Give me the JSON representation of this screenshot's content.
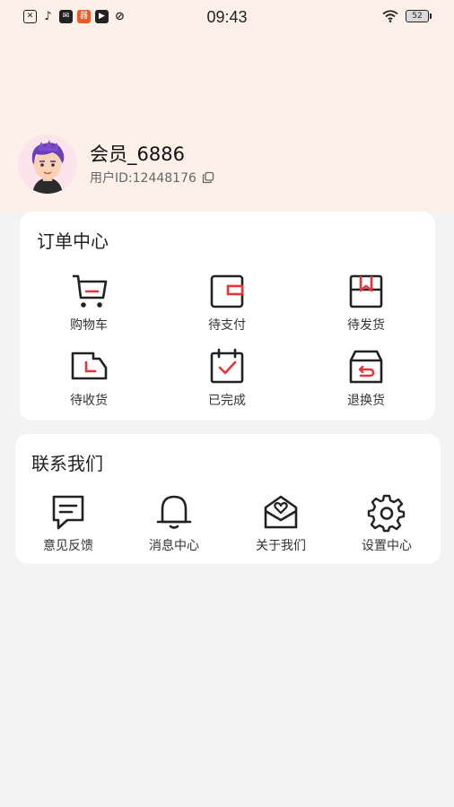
{
  "status_bar": {
    "time": "09:43",
    "battery": "52",
    "notification_icons": [
      "sim-icon",
      "tiktok-icon",
      "mail-icon",
      "app-icon",
      "video-icon",
      "link-icon"
    ],
    "app_icon_glyph": "器"
  },
  "profile": {
    "username": "会员_6886",
    "user_id": "用户ID:12448176"
  },
  "order_center": {
    "title": "订单中心",
    "items": [
      {
        "label": "购物车",
        "icon": "cart-icon"
      },
      {
        "label": "待支付",
        "icon": "wallet-icon"
      },
      {
        "label": "待发货",
        "icon": "box-bookmark-icon"
      },
      {
        "label": "待收货",
        "icon": "truck-icon"
      },
      {
        "label": "已完成",
        "icon": "calendar-check-icon"
      },
      {
        "label": "退换货",
        "icon": "return-box-icon"
      }
    ]
  },
  "contact_us": {
    "title": "联系我们",
    "items": [
      {
        "label": "意见反馈",
        "icon": "feedback-icon"
      },
      {
        "label": "消息中心",
        "icon": "bell-icon"
      },
      {
        "label": "关于我们",
        "icon": "envelope-heart-icon"
      },
      {
        "label": "设置中心",
        "icon": "gear-icon"
      }
    ]
  },
  "colors": {
    "accent": "#e8333a",
    "header_bg": "#fdf0e8",
    "page_bg": "#f3f3f4"
  }
}
